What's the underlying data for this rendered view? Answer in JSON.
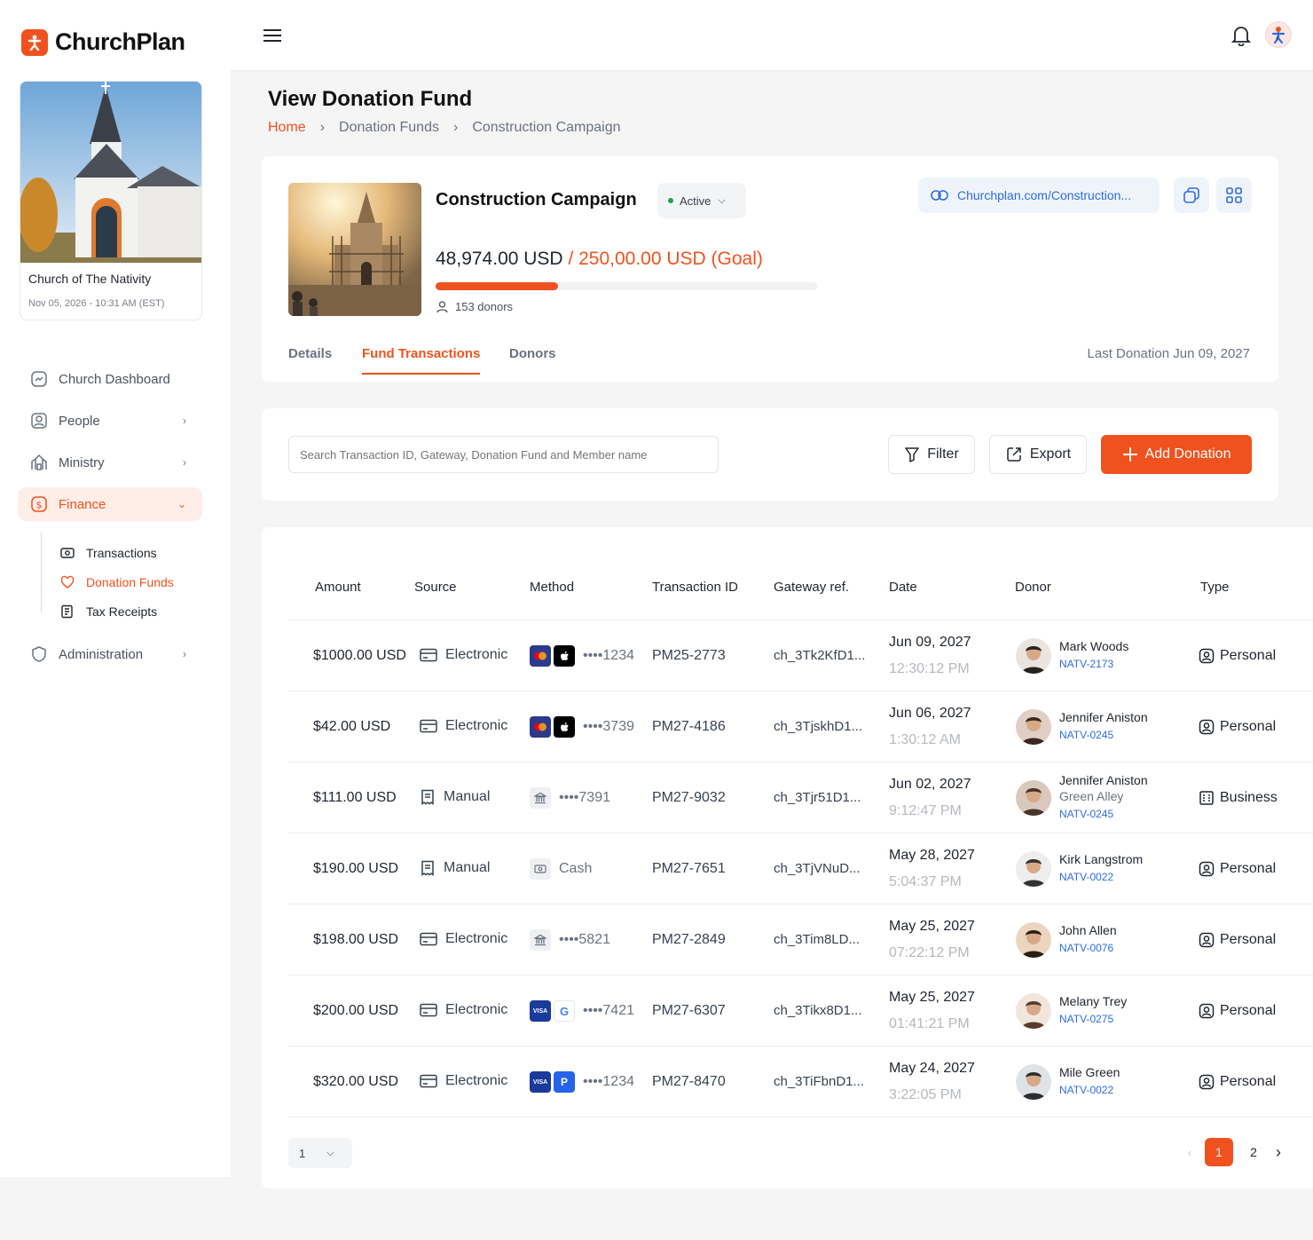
{
  "app": {
    "name": "ChurchPlan"
  },
  "church": {
    "name": "Church of The Nativity",
    "datetime": "Nov 05, 2026 - 10:31 AM (EST)"
  },
  "sidebar": {
    "items": [
      {
        "label": "Church Dashboard",
        "icon": "dashboard-icon"
      },
      {
        "label": "People",
        "icon": "people-icon"
      },
      {
        "label": "Ministry",
        "icon": "ministry-icon"
      },
      {
        "label": "Finance",
        "icon": "finance-icon",
        "active": true
      },
      {
        "label": "Administration",
        "icon": "shield-icon"
      }
    ],
    "finance_sub": [
      {
        "label": "Transactions",
        "icon": "transactions-icon"
      },
      {
        "label": "Donation Funds",
        "icon": "heart-icon",
        "active": true
      },
      {
        "label": "Tax Receipts",
        "icon": "receipt-icon"
      }
    ]
  },
  "page": {
    "title": "View Donation Fund"
  },
  "breadcrumb": {
    "home": "Home",
    "level1": "Donation Funds",
    "level2": "Construction Campaign"
  },
  "fund": {
    "name": "Construction Campaign",
    "status": "Active",
    "link": "Churchplan.com/Construction...",
    "raised": "48,974.00 USD",
    "goal_text": "/ 250,00.00 USD (Goal)",
    "progress_fraction": 0.32,
    "donors": "153 donors",
    "last_donation": "Last Donation Jun 09, 2027"
  },
  "tabs": {
    "details": "Details",
    "transactions": "Fund Transactions",
    "donors": "Donors"
  },
  "toolbar": {
    "search_placeholder": "Search Transaction ID, Gateway, Donation Fund and Member name",
    "filter": "Filter",
    "export": "Export",
    "add": "Add Donation"
  },
  "table": {
    "headers": {
      "amount": "Amount",
      "source": "Source",
      "method": "Method",
      "txid": "Transaction ID",
      "gateway": "Gateway ref.",
      "date": "Date",
      "donor": "Donor",
      "type": "Type"
    },
    "rows": [
      {
        "amount": "$1000.00 USD",
        "source": "Electronic",
        "method_logos": [
          "mastercard",
          "apple"
        ],
        "method": "••••1234",
        "txid": "PM25-2773",
        "gateway": "ch_3Tk2KfD1...",
        "date": "Jun 09, 2027",
        "time": "12:30:12 PM",
        "donor": "Mark Woods",
        "donor_sub": "",
        "donor_id": "NATV-2173",
        "type": "Personal"
      },
      {
        "amount": "$42.00 USD",
        "source": "Electronic",
        "method_logos": [
          "mastercard",
          "apple"
        ],
        "method": "••••3739",
        "txid": "PM27-4186",
        "gateway": "ch_3TjskhD1...",
        "date": "Jun 06, 2027",
        "time": "1:30:12 AM",
        "donor": "Jennifer Aniston",
        "donor_sub": "",
        "donor_id": "NATV-0245",
        "type": "Personal"
      },
      {
        "amount": "$111.00 USD",
        "source": "Manual",
        "method_logos": [
          "bank"
        ],
        "method": "••••7391",
        "txid": "PM27-9032",
        "gateway": "ch_3Tjr51D1...",
        "date": "Jun 02, 2027",
        "time": "9:12:47 PM",
        "donor": "Jennifer Aniston",
        "donor_sub": "Green Alley",
        "donor_id": "NATV-0245",
        "type": "Business"
      },
      {
        "amount": "$190.00 USD",
        "source": "Manual",
        "method_logos": [
          "cash"
        ],
        "method": "Cash",
        "txid": "PM27-7651",
        "gateway": "ch_3TjVNuD...",
        "date": "May 28, 2027",
        "time": "5:04:37 PM",
        "donor": "Kirk Langstrom",
        "donor_sub": "",
        "donor_id": "NATV-0022",
        "type": "Personal"
      },
      {
        "amount": "$198.00 USD",
        "source": "Electronic",
        "method_logos": [
          "bank"
        ],
        "method": "••••5821",
        "txid": "PM27-2849",
        "gateway": "ch_3Tim8LD...",
        "date": "May 25, 2027",
        "time": "07:22:12 PM",
        "donor": "John Allen",
        "donor_sub": "",
        "donor_id": "NATV-0076",
        "type": "Personal"
      },
      {
        "amount": "$200.00 USD",
        "source": "Electronic",
        "method_logos": [
          "visa",
          "google"
        ],
        "method": "••••7421",
        "txid": "PM27-6307",
        "gateway": "ch_3Tikx8D1...",
        "date": "May 25, 2027",
        "time": "01:41:21 PM",
        "donor": "Melany Trey",
        "donor_sub": "",
        "donor_id": "NATV-0275",
        "type": "Personal"
      },
      {
        "amount": "$320.00 USD",
        "source": "Electronic",
        "method_logos": [
          "visa",
          "paypal"
        ],
        "method": "••••1234",
        "txid": "PM27-8470",
        "gateway": "ch_3TiFbnD1...",
        "date": "May 24, 2027",
        "time": "3:22:05 PM",
        "donor": "Mile Green",
        "donor_sub": "",
        "donor_id": "NATV-0022",
        "type": "Personal"
      }
    ]
  },
  "pagination": {
    "per_page": "1",
    "pages": [
      "1",
      "2"
    ],
    "current": "1"
  },
  "colors": {
    "accent": "#f0521f",
    "link": "#2d6cdf"
  }
}
